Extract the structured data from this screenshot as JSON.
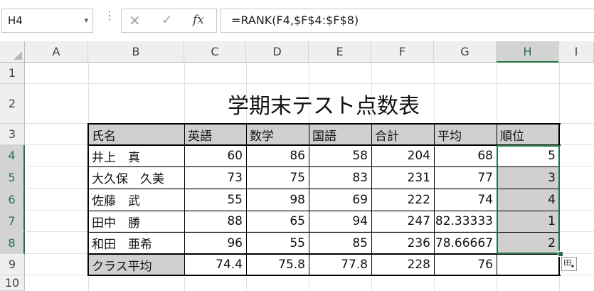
{
  "formula_bar": {
    "name_box": "H4",
    "name_box_arrow": "▾",
    "dots": "⋮",
    "cancel_icon": "✕",
    "enter_icon": "✓",
    "fx_label": "fx",
    "formula": "=RANK(F4,$F$4:$F$8)"
  },
  "columns": [
    "A",
    "B",
    "C",
    "D",
    "E",
    "F",
    "G",
    "H",
    "I"
  ],
  "rows": [
    "1",
    "2",
    "3",
    "4",
    "5",
    "6",
    "7",
    "8",
    "9",
    "10"
  ],
  "sheet": {
    "title": "学期末テスト点数表",
    "headers": [
      "氏名",
      "英語",
      "数学",
      "国語",
      "合計",
      "平均",
      "順位"
    ],
    "data": [
      [
        "井上　真",
        "60",
        "86",
        "58",
        "204",
        "68",
        "5"
      ],
      [
        "大久保　久美",
        "73",
        "75",
        "83",
        "231",
        "77",
        "3"
      ],
      [
        "佐藤　武",
        "55",
        "98",
        "69",
        "222",
        "74",
        "4"
      ],
      [
        "田中　勝",
        "88",
        "65",
        "94",
        "247",
        "82.33333",
        "1"
      ],
      [
        "和田　亜希",
        "96",
        "55",
        "85",
        "236",
        "78.66667",
        "2"
      ]
    ],
    "average_row": [
      "クラス平均",
      "74.4",
      "75.8",
      "77.8",
      "228",
      "76",
      ""
    ]
  },
  "selected_column": "H",
  "selected_rows": [
    "4",
    "5",
    "6",
    "7",
    "8"
  ],
  "quick_analysis_icon": "quick-analysis-icon"
}
